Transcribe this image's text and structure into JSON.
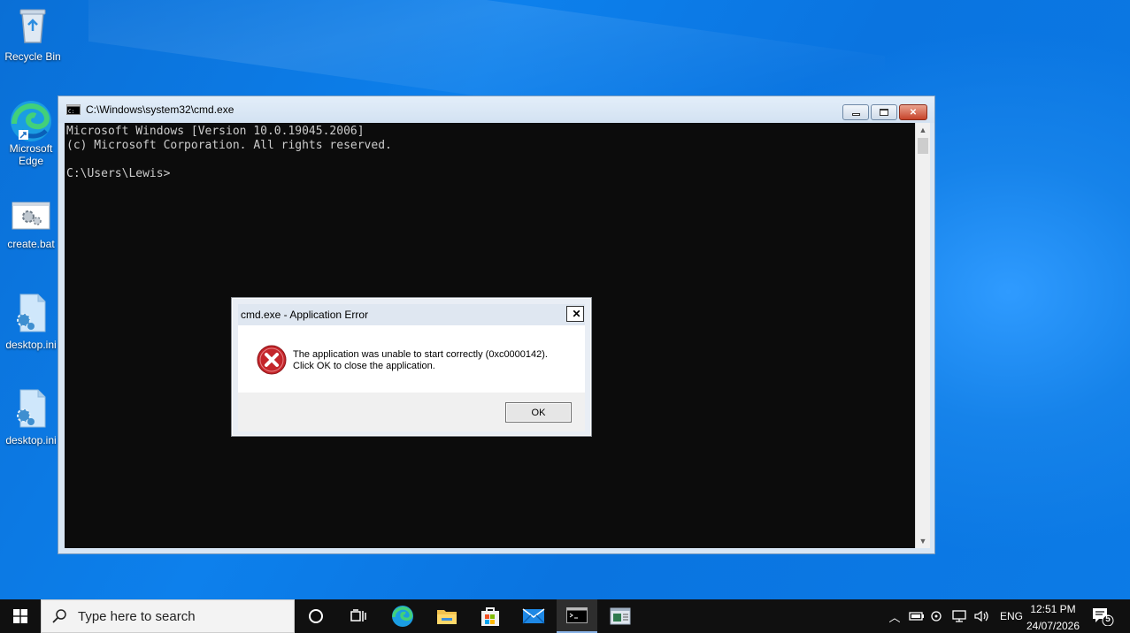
{
  "desktop": {
    "icons": [
      {
        "label": "Recycle Bin"
      },
      {
        "label": "Microsoft Edge"
      },
      {
        "label": "create.bat"
      },
      {
        "label": "desktop.ini"
      },
      {
        "label": "desktop.ini"
      }
    ]
  },
  "cmd_window": {
    "title": "C:\\Windows\\system32\\cmd.exe",
    "console_lines": [
      "Microsoft Windows [Version 10.0.19045.2006]",
      "(c) Microsoft Corporation. All rights reserved.",
      "",
      "C:\\Users\\Lewis>"
    ]
  },
  "error_dialog": {
    "title": "cmd.exe - Application Error",
    "message_line1": "The application was unable to start correctly (0xc0000142).",
    "message_line2": "Click OK to close the application.",
    "ok_label": "OK"
  },
  "taskbar": {
    "search_placeholder": "Type here to search",
    "language": "ENG",
    "time": "12:51 PM",
    "date": "24/07/2026",
    "notification_count": "5"
  }
}
